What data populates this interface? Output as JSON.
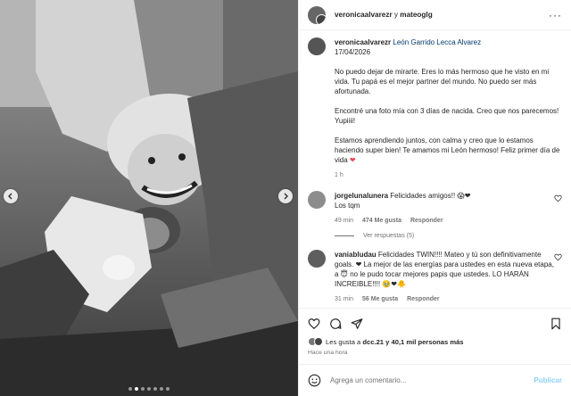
{
  "header": {
    "user1": "veronicaalvarezr",
    "joiner": " y ",
    "user2": "mateoglg",
    "more_label": "···"
  },
  "caption": {
    "username": "veronicaalvarezr",
    "mention": "León Garrido Lecca Alvarez",
    "date": "17/04/2026",
    "paragraphs": [
      "No puedo dejar de mirarte. Eres lo más hermoso que he visto en mi vida. Tu papá es el mejor partner del mundo. No puedo ser más afortunada.",
      "Encontré una foto mía con 3 días de nacida. Creo que nos parecemos! Yupiiii!",
      "Estamos aprendiendo juntos, con calma y creo que lo estamos haciendo super bien! Te amamos mi León hermoso! Feliz primer día de vida"
    ],
    "heart": "❤",
    "time": "1 h"
  },
  "comments": [
    {
      "username": "jorgelunalunera",
      "text": "Felicidades amigos!! 😱❤",
      "text2": "Los tqm",
      "time": "49 min",
      "likes": "474 Me gusta",
      "reply": "Responder",
      "view_replies": "Ver respuestas (5)"
    },
    {
      "username": "vaniabludau",
      "text": "Felicidades TWIN!!!! Mateo y tú son definitivamente goals. ❤ La mejor de las energías para ustedes en esta nueva etapa, a 😇 no le pudo tocar mejores papis que ustedes. LO HARÁN INCREIBLE!!!! 🥹❤🐥",
      "time": "31 min",
      "likes": "56 Me gusta",
      "reply": "Responder"
    }
  ],
  "actions": {
    "likes_text_prefix": "Les gusta a ",
    "likes_user": "dcc.21",
    "likes_text_suffix": " y 40,1 mil personas más",
    "posted_ago": "Hace una hora"
  },
  "add_comment": {
    "placeholder": "Agrega un comentario...",
    "post_label": "Publicar"
  },
  "carousel": {
    "slide_count": 7,
    "active_index": 1
  }
}
